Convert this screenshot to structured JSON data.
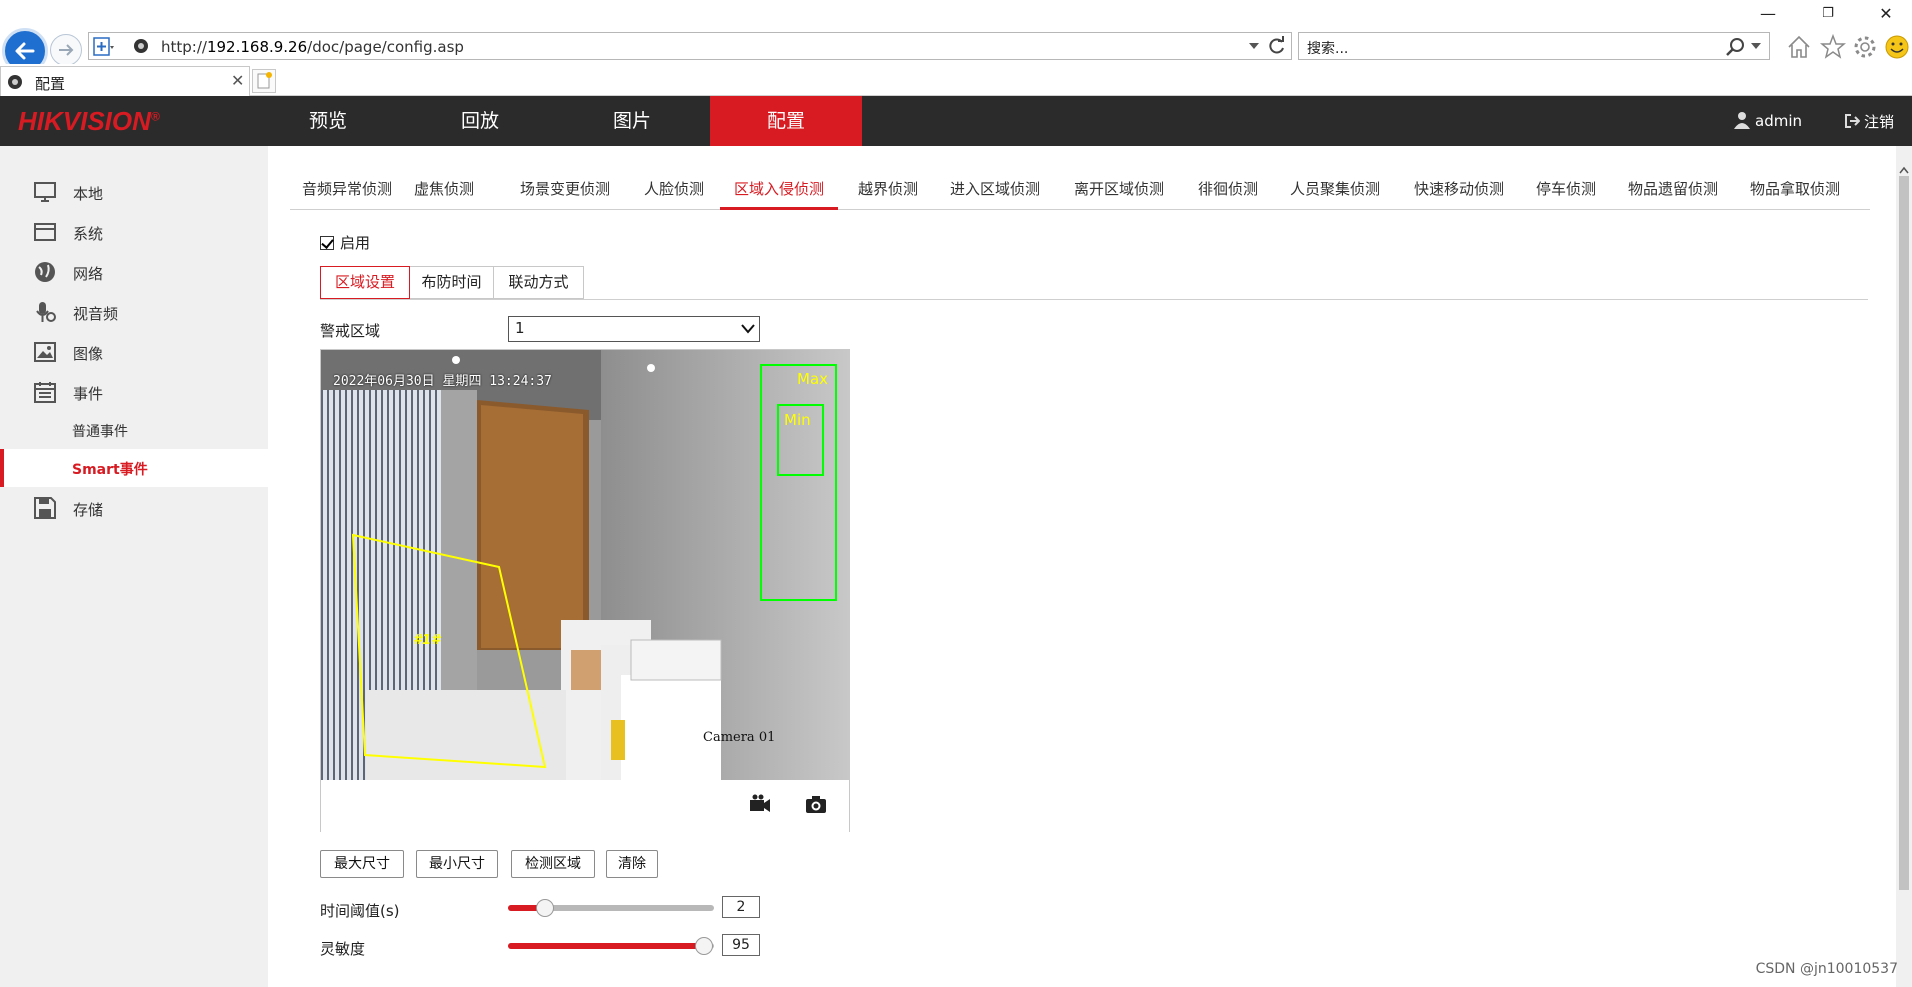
{
  "browser": {
    "url_prefix": "http://",
    "url_host": "192.168.9.26",
    "url_path": "/doc/page/config.asp",
    "search_placeholder": "搜索...",
    "tab_title": "配置",
    "window_controls": {
      "minimize": "—",
      "restore": "❐",
      "close": "✕"
    }
  },
  "app": {
    "logo": "HIKVISION",
    "logo_mark": "®",
    "nav": [
      {
        "label": "预览"
      },
      {
        "label": "回放"
      },
      {
        "label": "图片"
      },
      {
        "label": "配置",
        "active": true
      }
    ],
    "user": "admin",
    "logout": "注销"
  },
  "sidebar": {
    "items": [
      {
        "label": "本地",
        "icon": "monitor-icon"
      },
      {
        "label": "系统",
        "icon": "system-window-icon"
      },
      {
        "label": "网络",
        "icon": "globe-icon"
      },
      {
        "label": "视音频",
        "icon": "mic-icon"
      },
      {
        "label": "图像",
        "icon": "image-icon"
      },
      {
        "label": "事件",
        "icon": "calendar-icon"
      },
      {
        "label": "存储",
        "icon": "save-disk-icon"
      }
    ],
    "sub_items": [
      {
        "label": "普通事件"
      },
      {
        "label": "Smart事件",
        "active": true
      }
    ]
  },
  "subtabs": [
    "音频异常侦测",
    "虚焦侦测",
    "场景变更侦测",
    "人脸侦测",
    "区域入侵侦测",
    "越界侦测",
    "进入区域侦测",
    "离开区域侦测",
    "徘徊侦测",
    "人员聚集侦测",
    "快速移动侦测",
    "停车侦测",
    "物品遗留侦测",
    "物品拿取侦测"
  ],
  "active_subtab": "区域入侵侦测",
  "enable_label": "启用",
  "enable_checked": true,
  "steps": [
    "区域设置",
    "布防时间",
    "联动方式"
  ],
  "active_step": "区域设置",
  "zone": {
    "label": "警戒区域",
    "value": "1"
  },
  "video": {
    "osd_time": "2022年06月30日 星期四 13:24:37",
    "osd_camera": "Camera 01",
    "max_label": "Max",
    "min_label": "Min",
    "zone_tag": "#1#",
    "record_icon": "video-record-icon",
    "capture_icon": "camera-capture-icon"
  },
  "buttons": [
    "最大尺寸",
    "最小尺寸",
    "检测区域",
    "清除"
  ],
  "sliders": {
    "time_threshold": {
      "label": "时间阈值(s)",
      "value": "2",
      "fraction": 0.18
    },
    "sensitivity": {
      "label": "灵敏度",
      "value": "95",
      "fraction": 0.95
    }
  },
  "watermark": "CSDN @jn10010537",
  "colors": {
    "brand_red": "#d81b22",
    "header_bg": "#2b2b2b",
    "zone_yellow": "#ffff00",
    "size_box_green": "#00ff00"
  }
}
